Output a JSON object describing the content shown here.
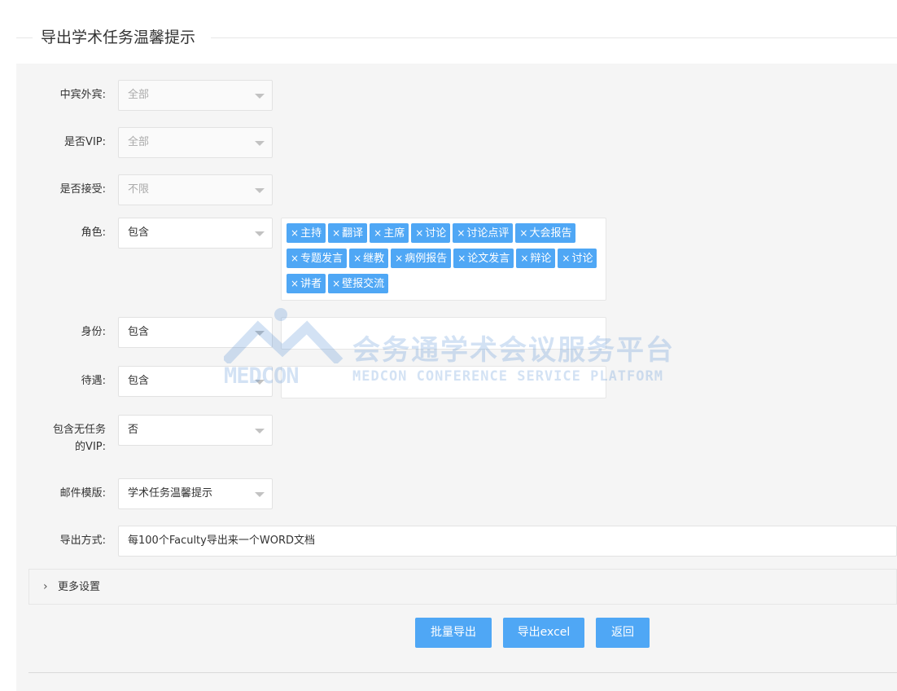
{
  "header": {
    "title": "导出学术任务温馨提示"
  },
  "form": {
    "guest_type": {
      "label": "中宾外宾:",
      "value": "全部"
    },
    "is_vip": {
      "label": "是否VIP:",
      "value": "全部"
    },
    "accepted": {
      "label": "是否接受:",
      "value": "不限"
    },
    "role": {
      "label": "角色:",
      "mode": "包含",
      "tags": [
        "主持",
        "翻译",
        "主席",
        "讨论",
        "讨论点评",
        "大会报告",
        "专题发言",
        "继教",
        "病例报告",
        "论文发言",
        "辩论",
        "讨论",
        "讲者",
        "壁报交流"
      ]
    },
    "identity": {
      "label": "身份:",
      "mode": "包含"
    },
    "treatment": {
      "label": "待遇:",
      "mode": "包含"
    },
    "include_vip_no_task": {
      "label_line1": "包含无任务",
      "label_line2": "的VIP:",
      "value": "否"
    },
    "mail_template": {
      "label": "邮件模版:",
      "value": "学术任务温馨提示"
    },
    "export_mode": {
      "label": "导出方式:",
      "value": "每100个Faculty导出来一个WORD文档"
    }
  },
  "more_settings": {
    "label": "更多设置",
    "icon": "chevron-right-icon"
  },
  "buttons": {
    "batch_export": "批量导出",
    "export_excel": "导出excel",
    "back": "返回"
  },
  "watermark": {
    "logo_text": "MEDCON",
    "cn_text": "会务通学术会议服务平台",
    "en_text": "MEDCON CONFERENCE SERVICE PLATFORM"
  },
  "colors": {
    "accent": "#4fa7f5",
    "panel_bg": "#f5f5f5"
  }
}
